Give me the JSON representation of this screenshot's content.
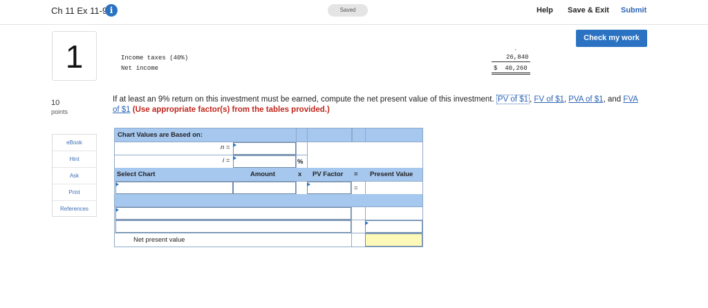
{
  "header": {
    "title": "Ch 11 Ex 11-9",
    "info_icon": "info-icon",
    "saved": "Saved",
    "help": "Help",
    "save_exit": "Save & Exit",
    "submit": "Submit"
  },
  "check_work": "Check my work",
  "question": {
    "number": "1",
    "points": "10",
    "points_label": "points",
    "tools": [
      "eBook",
      "Hint",
      "Ask",
      "Print",
      "References"
    ]
  },
  "income_fragment": {
    "rows": [
      {
        "label": "Income taxes (40%)",
        "value": "26,840"
      },
      {
        "label": "Net income",
        "value": "$  40,260"
      }
    ]
  },
  "prompt": {
    "text": "If at least an 9% return on this investment must be earned, compute the net present value of this investment.",
    "links": [
      "PV of $1",
      "FV of $1",
      "PVA of $1",
      "FVA of $1"
    ],
    "and": ", and ",
    "instruction": "(Use appropriate factor(s) from the tables provided.)"
  },
  "table": {
    "chart_values_label": "Chart Values are Based on:",
    "n_label": "n =",
    "i_label": "i =",
    "percent": "%",
    "select_chart": "Select Chart",
    "amount": "Amount",
    "times": "x",
    "pv_factor": "PV Factor",
    "equals": "=",
    "present_value": "Present Value",
    "net_present_value": "Net present value"
  }
}
